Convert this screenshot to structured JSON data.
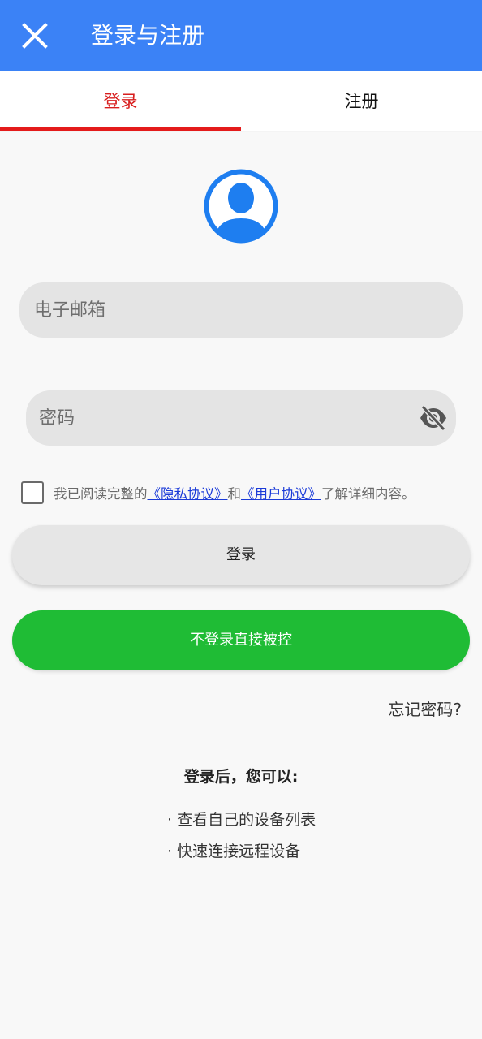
{
  "header": {
    "title": "登录与注册",
    "close_icon": "close-icon"
  },
  "tabs": [
    {
      "label": "登录",
      "active": true
    },
    {
      "label": "注册",
      "active": false
    }
  ],
  "form": {
    "avatar_icon": "user-avatar-icon",
    "email_placeholder": "电子邮箱",
    "email_value": "",
    "password_placeholder": "密码",
    "password_value": "",
    "password_visibility_icon": "eye-off-icon"
  },
  "agreement": {
    "checked": false,
    "prefix": "我已阅读完整的",
    "privacy_link": "《隐私协议》",
    "middle": "和",
    "user_link": "《用户协议》",
    "suffix": "了解详细内容。"
  },
  "buttons": {
    "login": "登录",
    "guest": "不登录直接被控"
  },
  "forgot": "忘记密码?",
  "info": {
    "title": "登录后，您可以:",
    "items": [
      "· 查看自己的设备列表",
      "· 快速连接远程设备"
    ]
  },
  "colors": {
    "header_bg": "#3b82f6",
    "active_tab": "#d81e1e",
    "indicator": "#e41b1b",
    "guest_button": "#1fbc35",
    "link": "#1a3ad8",
    "avatar": "#1e7ef0"
  }
}
